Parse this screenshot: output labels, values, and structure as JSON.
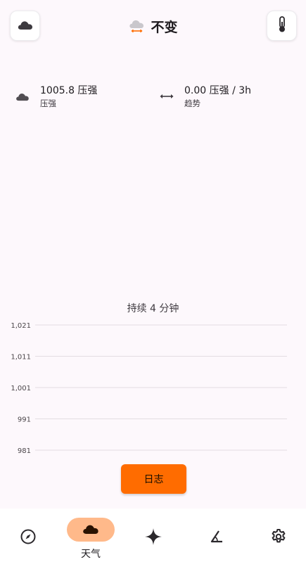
{
  "header": {
    "title": "不变",
    "left_button_icon": "cloud-icon",
    "right_button_icon": "thermometer-icon",
    "title_icon": "cloud-steady-icon"
  },
  "stats": {
    "pressure": {
      "value": "1005.8 压强",
      "label": "压强",
      "icon": "cloud-icon"
    },
    "trend": {
      "value": "0.00 压强 / 3h",
      "label": "趋势",
      "icon": "double-arrow-icon"
    }
  },
  "chart_data": {
    "type": "line",
    "title": "持续 4 分钟",
    "y_ticks": [
      "1,021",
      "1,011",
      "1,001",
      "991",
      "981"
    ],
    "ylim": [
      981,
      1021
    ],
    "grid": true,
    "series": [],
    "gridline_color": "#e3dde2"
  },
  "actions": {
    "log_label": "日志"
  },
  "nav": {
    "items": [
      {
        "icon": "compass-icon",
        "label": "",
        "active": false
      },
      {
        "icon": "cloud-icon",
        "label": "天气",
        "active": true
      },
      {
        "icon": "sparkle-icon",
        "label": "",
        "active": false
      },
      {
        "icon": "angle-icon",
        "label": "",
        "active": false
      },
      {
        "icon": "gear-icon",
        "label": "",
        "active": false
      }
    ]
  },
  "colors": {
    "accent": "#ff6c00",
    "active_nav": "#ffb98a",
    "background": "#fdf8fc"
  }
}
